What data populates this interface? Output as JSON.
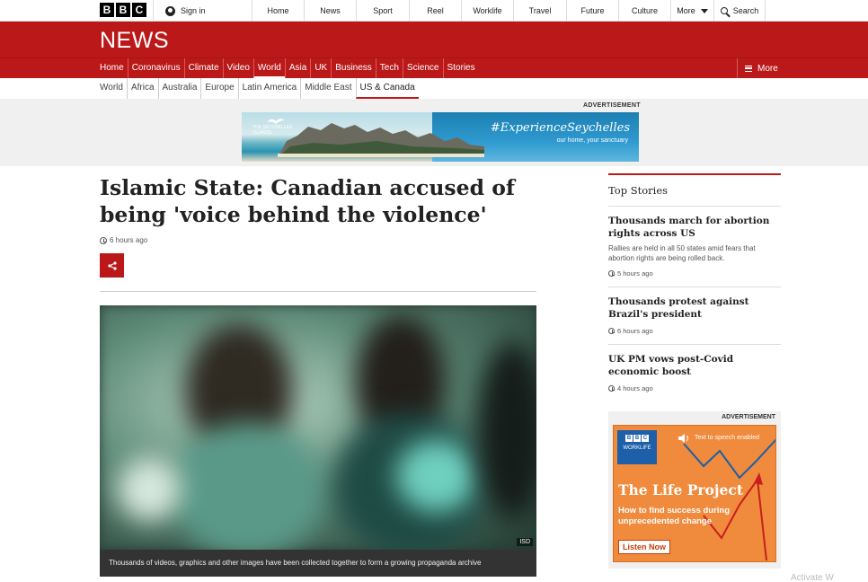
{
  "topbar": {
    "logo_letters": [
      "B",
      "B",
      "C"
    ],
    "signin_label": "Sign in",
    "nav": [
      {
        "label": "Home",
        "w": 58
      },
      {
        "label": "News",
        "w": 58
      },
      {
        "label": "Sport",
        "w": 59
      },
      {
        "label": "Reel",
        "w": 58
      },
      {
        "label": "Worklife",
        "w": 58
      },
      {
        "label": "Travel",
        "w": 59
      },
      {
        "label": "Future",
        "w": 58
      },
      {
        "label": "Culture",
        "w": 58
      }
    ],
    "more_label": "More",
    "search_label": "Search"
  },
  "masthead": {
    "title": "NEWS"
  },
  "mainnav": {
    "links": [
      "Home",
      "Coronavirus",
      "Climate",
      "Video",
      "World",
      "Asia",
      "UK",
      "Business",
      "Tech",
      "Science",
      "Stories"
    ],
    "active_index": 4,
    "more_label": "More"
  },
  "subnav": {
    "links": [
      "World",
      "Africa",
      "Australia",
      "Europe",
      "Latin America",
      "Middle East",
      "US & Canada"
    ],
    "active_index": 6
  },
  "top_ad": {
    "label": "ADVERTISEMENT",
    "tagline": "#ExperienceSeychelles",
    "subline": "our home, your sanctuary",
    "brand": "THE SEYCHELLES ISLANDS"
  },
  "article": {
    "headline": "Islamic State: Canadian accused of being 'voice behind the violence'",
    "timestamp": "6 hours ago",
    "image_credit": "ISD",
    "caption": "Thousands of videos, graphics and other images have been collected together to form a growing propaganda archive"
  },
  "sidebar": {
    "title": "Top Stories",
    "stories": [
      {
        "headline": "Thousands march for abortion rights across US",
        "summary": "Rallies are held in all 50 states amid fears that abortion rights are being rolled back.",
        "time": "5 hours ago"
      },
      {
        "headline": "Thousands protest against Brazil's president",
        "summary": "",
        "time": "6 hours ago"
      },
      {
        "headline": "UK PM vows post-Covid economic boost",
        "summary": "",
        "time": "4 hours ago"
      }
    ]
  },
  "side_ad": {
    "label": "ADVERTISEMENT",
    "badge_letters": [
      "B",
      "B",
      "C"
    ],
    "badge_text": "WORKLIFE",
    "tts": "Text to speech enabled",
    "title": "The Life Project",
    "subtitle": "How to find success during unprecedented change",
    "cta": "Listen Now"
  },
  "watermark": "Activate W"
}
